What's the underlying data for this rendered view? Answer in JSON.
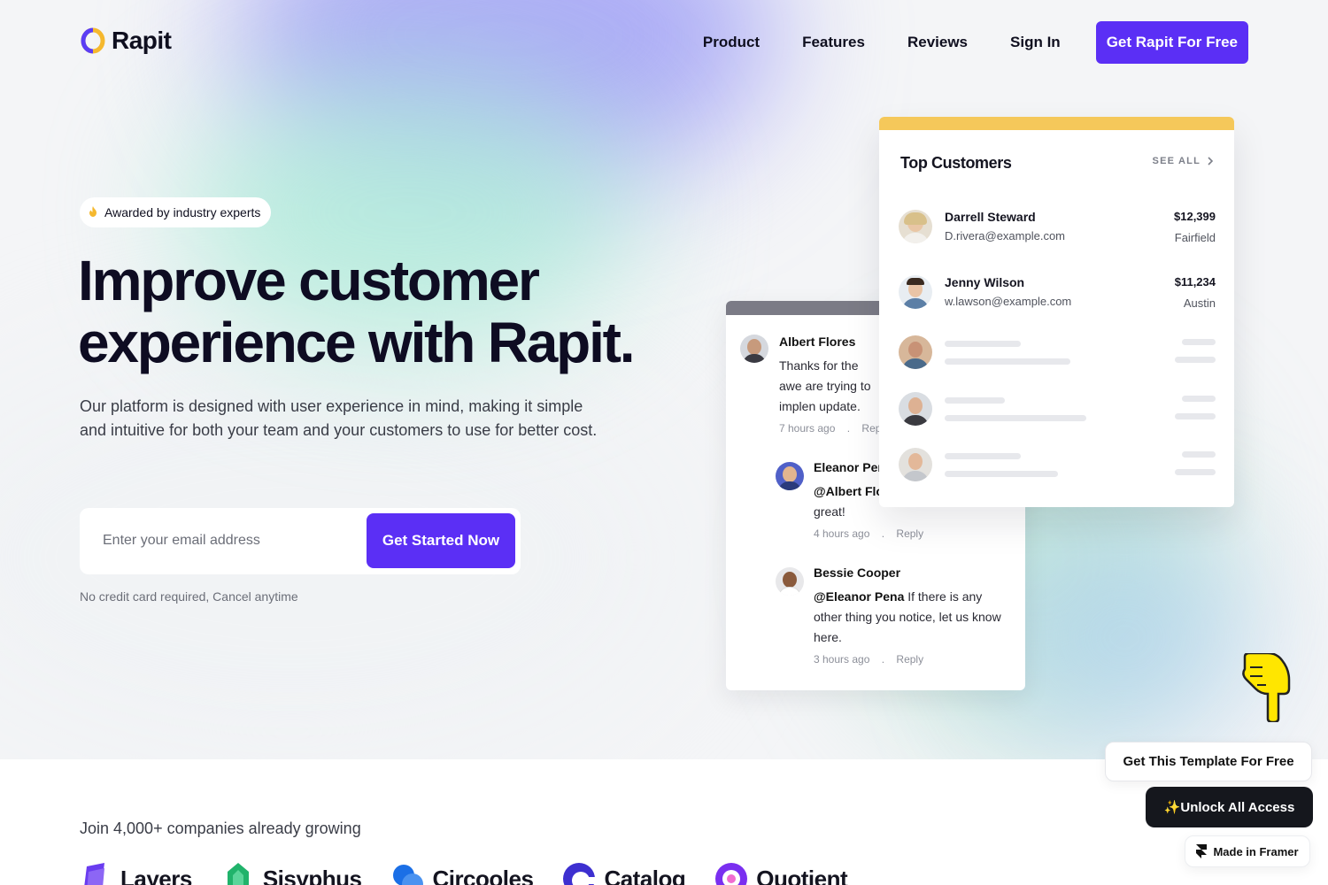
{
  "brand": {
    "name": "Rapit"
  },
  "nav": {
    "items": [
      {
        "label": "Product"
      },
      {
        "label": "Features"
      },
      {
        "label": "Reviews"
      },
      {
        "label": "Sign In"
      }
    ],
    "cta": "Get Rapit For Free"
  },
  "hero": {
    "badge": "Awarded by industry experts",
    "headline_line1": "Improve customer",
    "headline_line2": "experience with Rapit.",
    "subtext": "Our platform is designed with user experience in mind, making it simple and intuitive for both your team and your customers to use for better cost.",
    "email_placeholder": "Enter your email address",
    "submit_label": "Get Started Now",
    "note": "No credit card required, Cancel anytime"
  },
  "comments": [
    {
      "name": "Albert Flores",
      "text": "Thanks for the awe are trying to implen update. Cheers!",
      "time": "7 hours ago",
      "reply": "Reply"
    },
    {
      "name": "Eleanor Pen",
      "mention": "@Albert Flo",
      "text": "great!",
      "time": "4 hours ago",
      "reply": "Reply"
    },
    {
      "name": "Bessie Cooper",
      "mention": "@Eleanor Pena",
      "text": "If there is any other thing you notice, let us know here.",
      "time": "3 hours ago",
      "reply": "Reply"
    }
  ],
  "customers": {
    "title": "Top Customers",
    "see_all": "SEE ALL",
    "rows": [
      {
        "name": "Darrell Steward",
        "email": "D.rivera@example.com",
        "amount": "$12,399",
        "city": "Fairfield"
      },
      {
        "name": "Jenny Wilson",
        "email": "w.lawson@example.com",
        "amount": "$11,234",
        "city": "Austin"
      }
    ]
  },
  "social_proof": {
    "headline": "Join 4,000+ companies already growing",
    "logos": [
      {
        "name": "Layers",
        "icon": "layers-logo",
        "color": "#6a3cf0"
      },
      {
        "name": "Sisyphus",
        "icon": "sisyphus-logo",
        "color": "#20b36b"
      },
      {
        "name": "Circooles",
        "icon": "circooles-logo",
        "color": "#1b6fe6"
      },
      {
        "name": "Catalog",
        "icon": "catalog-logo",
        "color": "#3d2fd0"
      },
      {
        "name": "Quotient",
        "icon": "quotient-logo",
        "color": "#7a2ff0"
      }
    ]
  },
  "overlay": {
    "pointer_icon": "pointing-down-hand-icon",
    "get_template": "Get This Template For Free",
    "unlock": "✨Unlock All Access",
    "framer": "Made in Framer"
  },
  "colors": {
    "accent": "#5b2ff5",
    "yellow": "#f5c85a"
  }
}
